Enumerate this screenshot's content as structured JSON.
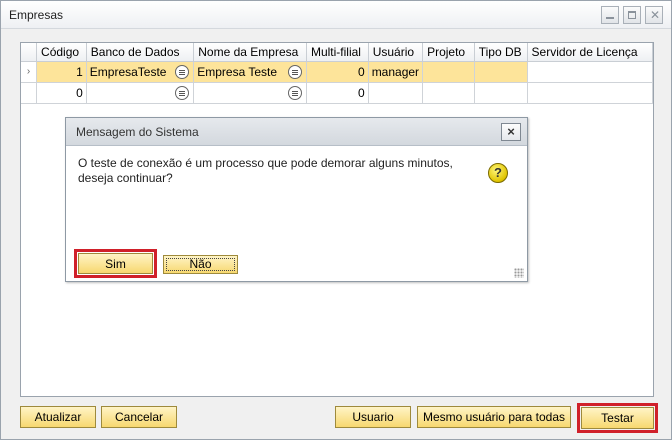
{
  "window": {
    "title": "Empresas"
  },
  "grid": {
    "columns": [
      "Código",
      "Banco de Dados",
      "Nome da Empresa",
      "Multi-filial",
      "Usuário",
      "Projeto",
      "Tipo DB",
      "Servidor de Licença"
    ],
    "row_marker": "›",
    "rows": [
      {
        "codigo": "1",
        "banco": "EmpresaTeste",
        "nome": "Empresa Teste",
        "multi": "0",
        "usuario": "manager",
        "projeto": "",
        "tipo": "",
        "servidor": ""
      },
      {
        "codigo": "0",
        "banco": "",
        "nome": "",
        "multi": "0",
        "usuario": "",
        "projeto": "",
        "tipo": "",
        "servidor": ""
      }
    ]
  },
  "dialog": {
    "title": "Mensagem do Sistema",
    "close": "×",
    "message": "O teste de conexão é um processo que pode demorar alguns minutos, deseja continuar?",
    "icon": "question-icon",
    "icon_glyph": "?",
    "yes": "Sim",
    "no": "Não"
  },
  "footer": {
    "atualizar": "Atualizar",
    "cancelar": "Cancelar",
    "usuario": "Usuario",
    "mesmo": "Mesmo usuário para todas",
    "testar": "Testar"
  },
  "colors": {
    "selected_row": "#fde49a",
    "button": "#f7d870",
    "highlight": "#d0202a"
  }
}
